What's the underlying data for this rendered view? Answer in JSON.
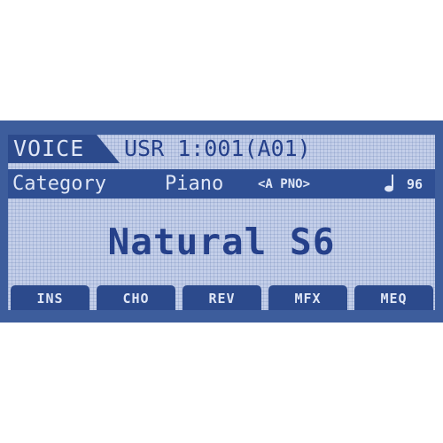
{
  "header": {
    "mode": "VOICE",
    "voice_id": "USR 1:001(A01)"
  },
  "category": {
    "label": "Category",
    "value": "Piano",
    "abbrev": "<A PNO>",
    "tempo_icon": "note-icon",
    "tempo": "96"
  },
  "voice": {
    "name": "Natural S6"
  },
  "buttons": [
    {
      "label": "INS"
    },
    {
      "label": "CHO"
    },
    {
      "label": "REV"
    },
    {
      "label": "MFX"
    },
    {
      "label": "MEQ"
    }
  ],
  "colors": {
    "lcd_background": "#c4cfe9",
    "lcd_ink": "#25408a",
    "bezel": "#3d5d9c",
    "inverse_text": "#dfe6f6"
  }
}
